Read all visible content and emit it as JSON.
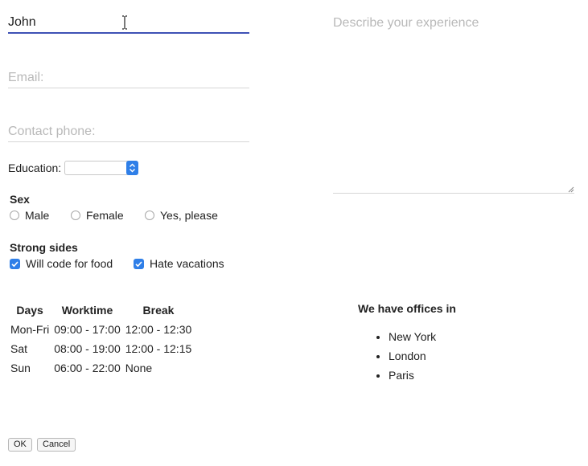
{
  "form": {
    "name_value": "John ",
    "email_placeholder": "Email:",
    "phone_placeholder": "Contact phone:",
    "education_label": "Education:",
    "education_selected": "",
    "sex_heading": "Sex",
    "sex_options": [
      "Male",
      "Female",
      "Yes, please"
    ],
    "strong_sides_heading": "Strong sides",
    "strong_sides": [
      {
        "label": "Will code for food",
        "checked": true
      },
      {
        "label": "Hate vacations",
        "checked": true
      }
    ],
    "experience_placeholder": "Describe your experience"
  },
  "schedule": {
    "headers": [
      "Days",
      "Worktime",
      "Break"
    ],
    "rows": [
      [
        "Mon-Fri",
        "09:00 - 17:00",
        "12:00 - 12:30"
      ],
      [
        "Sat",
        "08:00 - 19:00",
        "12:00 - 12:15"
      ],
      [
        "Sun",
        "06:00 - 22:00",
        "None"
      ]
    ]
  },
  "offices": {
    "title": "We have offices in",
    "items": [
      "New York",
      "London",
      "Paris"
    ]
  },
  "buttons": {
    "ok_label": "OK",
    "cancel_label": "Cancel"
  },
  "icons": {
    "text_cursor": "i-beam-cursor-icon",
    "select_arrow": "chevron-up-down-icon",
    "checkbox_check": "checkmark-icon",
    "resize": "resize-handle-icon"
  },
  "colors": {
    "accent": "#2f7fe8",
    "active_underline": "#3f51b5",
    "placeholder": "#b9b9b9"
  }
}
